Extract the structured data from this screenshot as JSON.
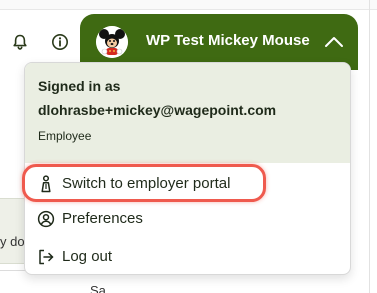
{
  "header": {
    "bell_icon": "bell-icon",
    "info_icon": "info-icon",
    "account": {
      "name": "WP Test Mickey Mouse",
      "avatar_icon": "mickey-avatar",
      "chevron_icon": "chevron-up-icon",
      "color": "#3f6a12"
    }
  },
  "dropdown": {
    "signed_in_label": "Signed in as",
    "email": "dlohrasbe+mickey@wagepoint.com",
    "role": "Employee",
    "header_bg": "#eaeee2",
    "items": [
      {
        "label": "Switch to employer portal",
        "icon": "person-switch-icon",
        "highlighted": true
      },
      {
        "label": "Preferences",
        "icon": "user-circle-icon"
      },
      {
        "label": "Log out",
        "icon": "logout-icon"
      }
    ]
  },
  "background": {
    "fragment_1": "y do",
    "fragment_2": "Sa",
    "highlight_color": "#ef5a4e"
  }
}
